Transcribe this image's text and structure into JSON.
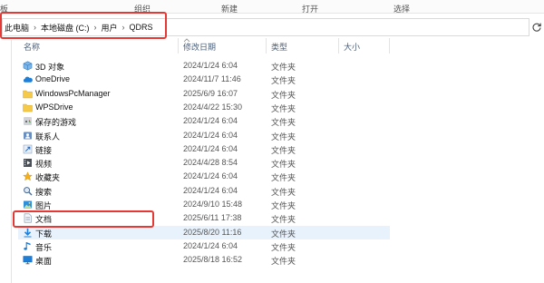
{
  "ribbon": {
    "groups": [
      "板",
      "组织",
      "新建",
      "打开",
      "选择"
    ]
  },
  "address_bar": {
    "breadcrumbs": [
      "此电脑",
      "本地磁盘 (C:)",
      "用户",
      "QDRS"
    ],
    "separator": "›",
    "highlight_color": "#e53935"
  },
  "columns": {
    "name": "名称",
    "date": "修改日期",
    "type": "类型",
    "size": "大小"
  },
  "files": [
    {
      "name": "3D 对象",
      "date": "2024/1/24 6:04",
      "type": "文件夹",
      "icon": "3d-objects-icon"
    },
    {
      "name": "OneDrive",
      "date": "2024/11/7 11:46",
      "type": "文件夹",
      "icon": "onedrive-cloud-icon"
    },
    {
      "name": "WindowsPcManager",
      "date": "2025/6/9 16:07",
      "type": "文件夹",
      "icon": "folder-icon"
    },
    {
      "name": "WPSDrive",
      "date": "2024/4/22 15:30",
      "type": "文件夹",
      "icon": "folder-icon"
    },
    {
      "name": "保存的游戏",
      "date": "2024/1/24 6:04",
      "type": "文件夹",
      "icon": "saved-games-icon"
    },
    {
      "name": "联系人",
      "date": "2024/1/24 6:04",
      "type": "文件夹",
      "icon": "contacts-icon"
    },
    {
      "name": "链接",
      "date": "2024/1/24 6:04",
      "type": "文件夹",
      "icon": "links-icon"
    },
    {
      "name": "视频",
      "date": "2024/4/28 8:54",
      "type": "文件夹",
      "icon": "videos-icon"
    },
    {
      "name": "收藏夹",
      "date": "2024/1/24 6:04",
      "type": "文件夹",
      "icon": "favorites-star-icon"
    },
    {
      "name": "搜索",
      "date": "2024/1/24 6:04",
      "type": "文件夹",
      "icon": "searches-icon"
    },
    {
      "name": "图片",
      "date": "2024/9/10 15:48",
      "type": "文件夹",
      "icon": "pictures-icon"
    },
    {
      "name": "文档",
      "date": "2025/6/11 17:38",
      "type": "文件夹",
      "icon": "documents-icon"
    },
    {
      "name": "下载",
      "date": "2025/8/20 11:16",
      "type": "文件夹",
      "icon": "downloads-arrow-icon",
      "selected": true
    },
    {
      "name": "音乐",
      "date": "2024/1/24 6:04",
      "type": "文件夹",
      "icon": "music-note-icon"
    },
    {
      "name": "桌面",
      "date": "2025/8/18 16:52",
      "type": "文件夹",
      "icon": "desktop-icon"
    }
  ]
}
